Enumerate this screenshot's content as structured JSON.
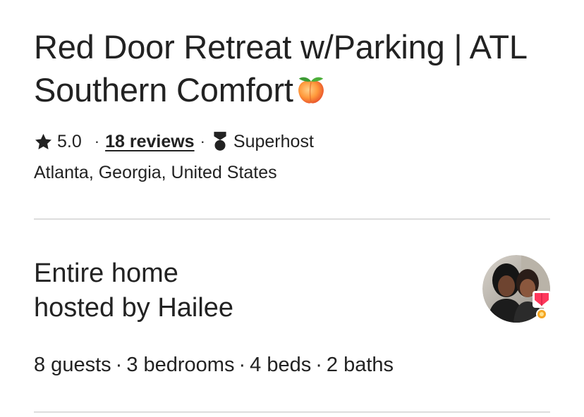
{
  "listing": {
    "title": "Red Door Retreat w/Parking | ATL Southern Comfort",
    "title_emoji_icon": "peach-emoji-icon",
    "rating": "5.0",
    "reviews_label": "18 reviews",
    "separator": "·",
    "superhost_label": "Superhost",
    "location": "Atlanta, Georgia, United States"
  },
  "host": {
    "heading_line1": "Entire home",
    "heading_line2": "hosted by Hailee",
    "avatar_icon": "host-avatar",
    "badge_icon": "superhost-medal-icon"
  },
  "capacity": {
    "guests": "8 guests",
    "bedrooms": "3 bedrooms",
    "beds": "4 beds",
    "baths": "2 baths",
    "separator": "·"
  },
  "colors": {
    "text": "#222222",
    "divider": "#dddddd",
    "badge_red": "#ff385c",
    "badge_gold": "#f5a623"
  }
}
